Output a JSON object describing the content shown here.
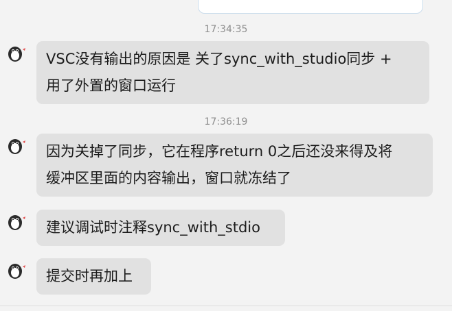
{
  "timestamps": [
    "17:34:35",
    "17:36:19"
  ],
  "messages": [
    {
      "text": "VSC没有输出的原因是 关了sync_with_studio同步 +\n用了外置的窗口运行"
    },
    {
      "text": "因为关掉了同步，它在程序return 0之后还没来得及将\n缓冲区里面的内容输出，窗口就冻结了"
    },
    {
      "text": "建议调试时注释sync_with_stdio"
    },
    {
      "text": "提交时再加上"
    }
  ],
  "colors": {
    "background": "#f3f3f3",
    "bubble": "#e1e1e1",
    "timestamp": "#8e8e8e",
    "text": "#1c1c1c"
  },
  "icons": {
    "avatar": "penguin-avatar-icon"
  }
}
